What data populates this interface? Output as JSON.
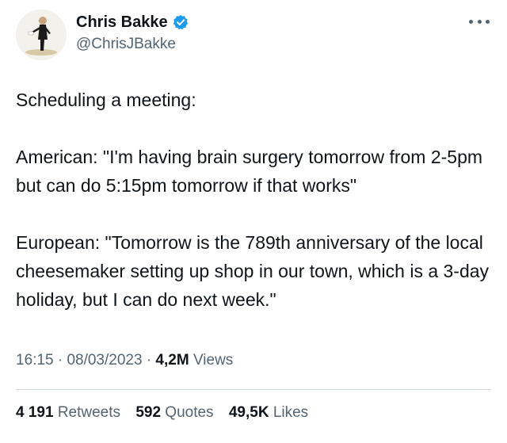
{
  "author": {
    "display_name": "Chris Bakke",
    "handle": "@ChrisJBakke",
    "verified_icon": "verified-badge-icon"
  },
  "more_icon": "more-horizontal-icon",
  "tweet": {
    "paragraphs": [
      "Scheduling a meeting:",
      "American: \"I'm having brain surgery tomorrow from 2-5pm but can do 5:15pm tomorrow if that works\"",
      "European: \"Tomorrow is the 789th anniversary of the local cheesemaker setting up shop in our town, which is a 3-day holiday, but I can do next week.\""
    ]
  },
  "meta": {
    "time": "16:15",
    "separator": "·",
    "date": "08/03/2023",
    "views_count": "4,2M",
    "views_label": "Views"
  },
  "stats": {
    "retweets_count": "4 191",
    "retweets_label": "Retweets",
    "quotes_count": "592",
    "quotes_label": "Quotes",
    "likes_count": "49,5K",
    "likes_label": "Likes"
  },
  "colors": {
    "text_primary": "#0f1419",
    "text_secondary": "#536471",
    "verified_blue": "#1d9bf0",
    "divider": "#cfd9de"
  }
}
